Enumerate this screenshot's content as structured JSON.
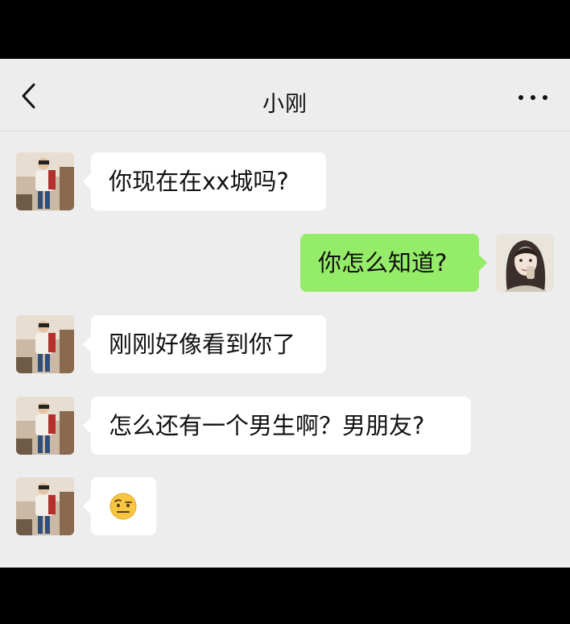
{
  "header": {
    "title": "小刚",
    "back_icon": "chevron-left-icon",
    "more_icon": "more-horizontal-icon"
  },
  "messages": [
    {
      "side": "incoming",
      "text": "你现在在xx城吗?"
    },
    {
      "side": "outgoing",
      "text": "你怎么知道?"
    },
    {
      "side": "incoming",
      "text": "刚刚好像看到你了"
    },
    {
      "side": "incoming",
      "text": "怎么还有一个男生啊？男朋友?"
    },
    {
      "side": "incoming",
      "emoji": "raised-eyebrow-emoji"
    }
  ],
  "colors": {
    "background": "#ededed",
    "incoming_bubble": "#ffffff",
    "outgoing_bubble": "#95ec69",
    "letterbox": "#000000"
  }
}
